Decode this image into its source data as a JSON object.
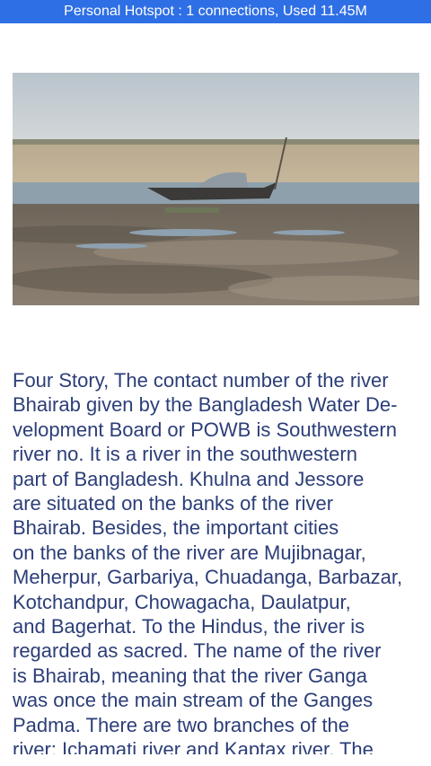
{
  "status_bar": {
    "text": "Personal Hotspot : 1 connections, Used 11.45M",
    "background": "#2f6fe5"
  },
  "photo": {
    "icon": "photo-river-boat"
  },
  "article": {
    "lines": [
      "Four Story, The contact number of the river",
      "Bhairab given by the Bangladesh Water De-",
      "velopment Board or POWB is Southwestern",
      "river no. It is a river in the southwestern",
      "part of Bangladesh. Khulna and Jessore",
      "are situated on the banks of the river",
      "Bhairab. Besides, the important cities",
      "on the banks of the river are Mujibnagar,",
      "Meherpur, Garbariya, Chuadanga, Barbazar,",
      "Kotchandpur, Chowagacha, Daulatpur,",
      "and Bagerhat. To the Hindus, the river is",
      "regarded as sacred. The name of the river",
      "is Bhairab, meaning that the river Ganga",
      "was once the main stream of the Ganges",
      "Padma. There are two branches of the",
      "river: Ichamati river and Kaptax river. The"
    ],
    "text_color": "#2c3e78"
  }
}
